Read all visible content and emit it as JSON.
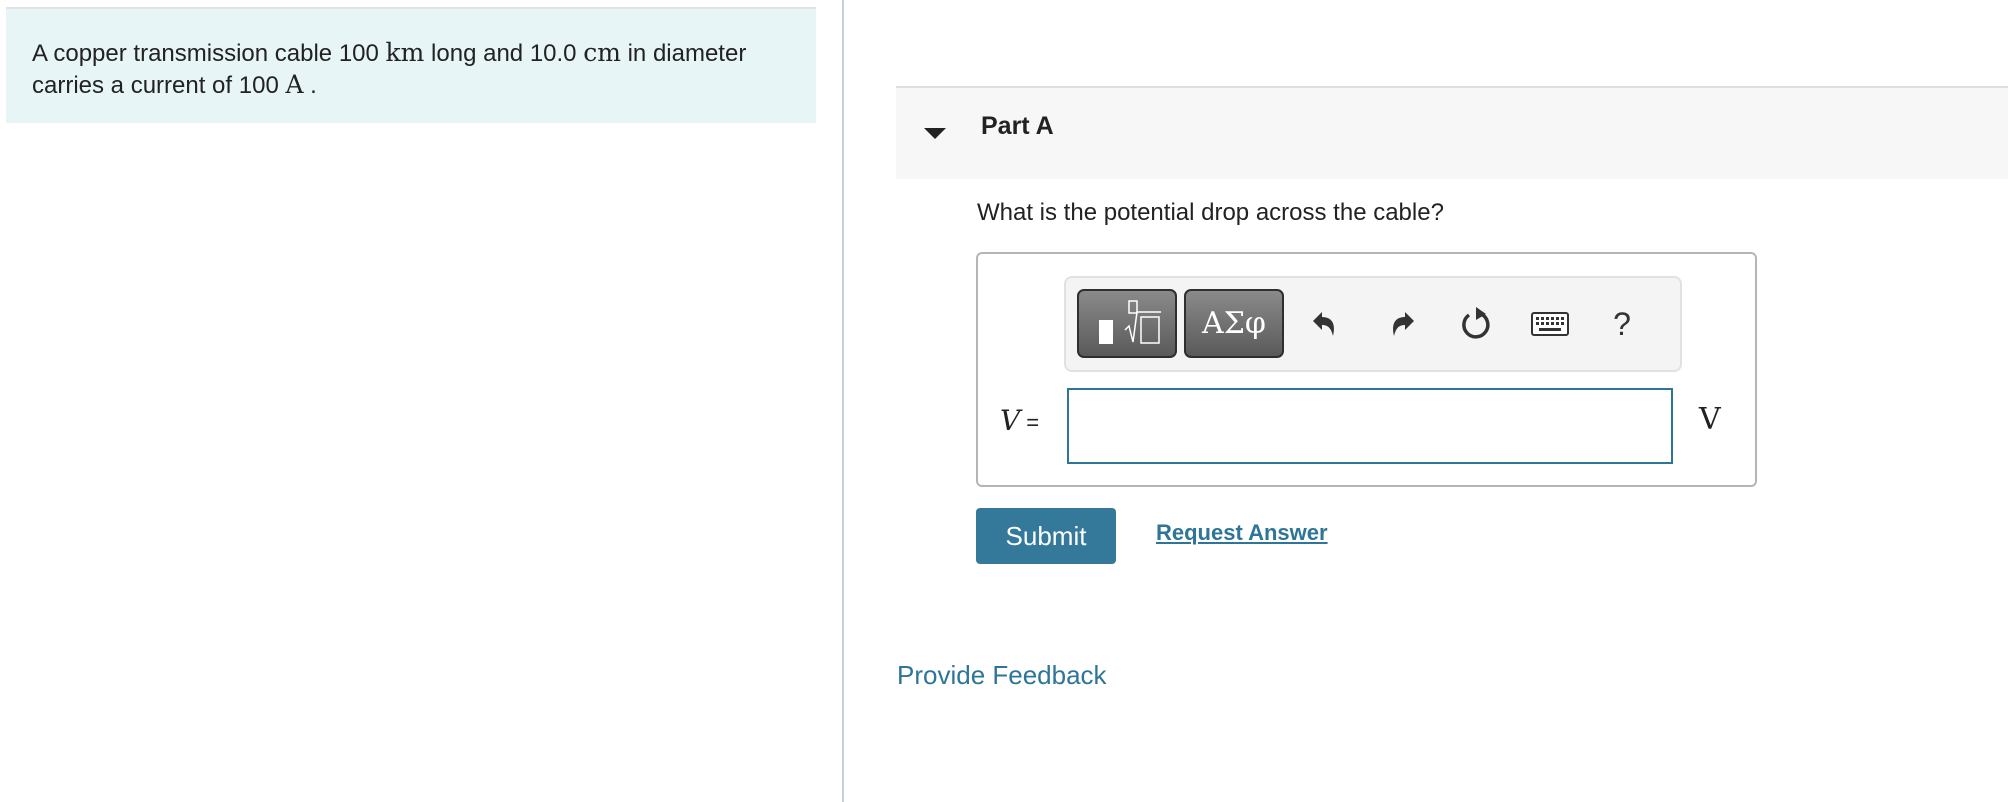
{
  "problem": {
    "text_1": "A copper transmission cable 100 ",
    "unit_km": "km",
    "text_2": " long and 10.0 ",
    "unit_cm": "cm",
    "text_3": " in diameter carries a current of 100 ",
    "unit_A": "A",
    "text_4": " ."
  },
  "part": {
    "title": "Part A",
    "question": "What is the potential drop across the cable?",
    "toolbar": {
      "symbols_label": "ΑΣφ",
      "help_label": "?",
      "icons": [
        "templates-icon",
        "symbols-icon",
        "undo-icon",
        "redo-icon",
        "reset-icon",
        "keyboard-icon",
        "help-icon"
      ]
    },
    "variable": "V",
    "equals": "=",
    "answer_value": "",
    "answer_placeholder": "",
    "unit": "V",
    "submit_label": "Submit",
    "request_answer_label": "Request Answer"
  },
  "feedback_label": "Provide Feedback",
  "colors": {
    "accent": "#347999",
    "link": "#2e7597",
    "intro_bg": "#e8f5f6"
  }
}
